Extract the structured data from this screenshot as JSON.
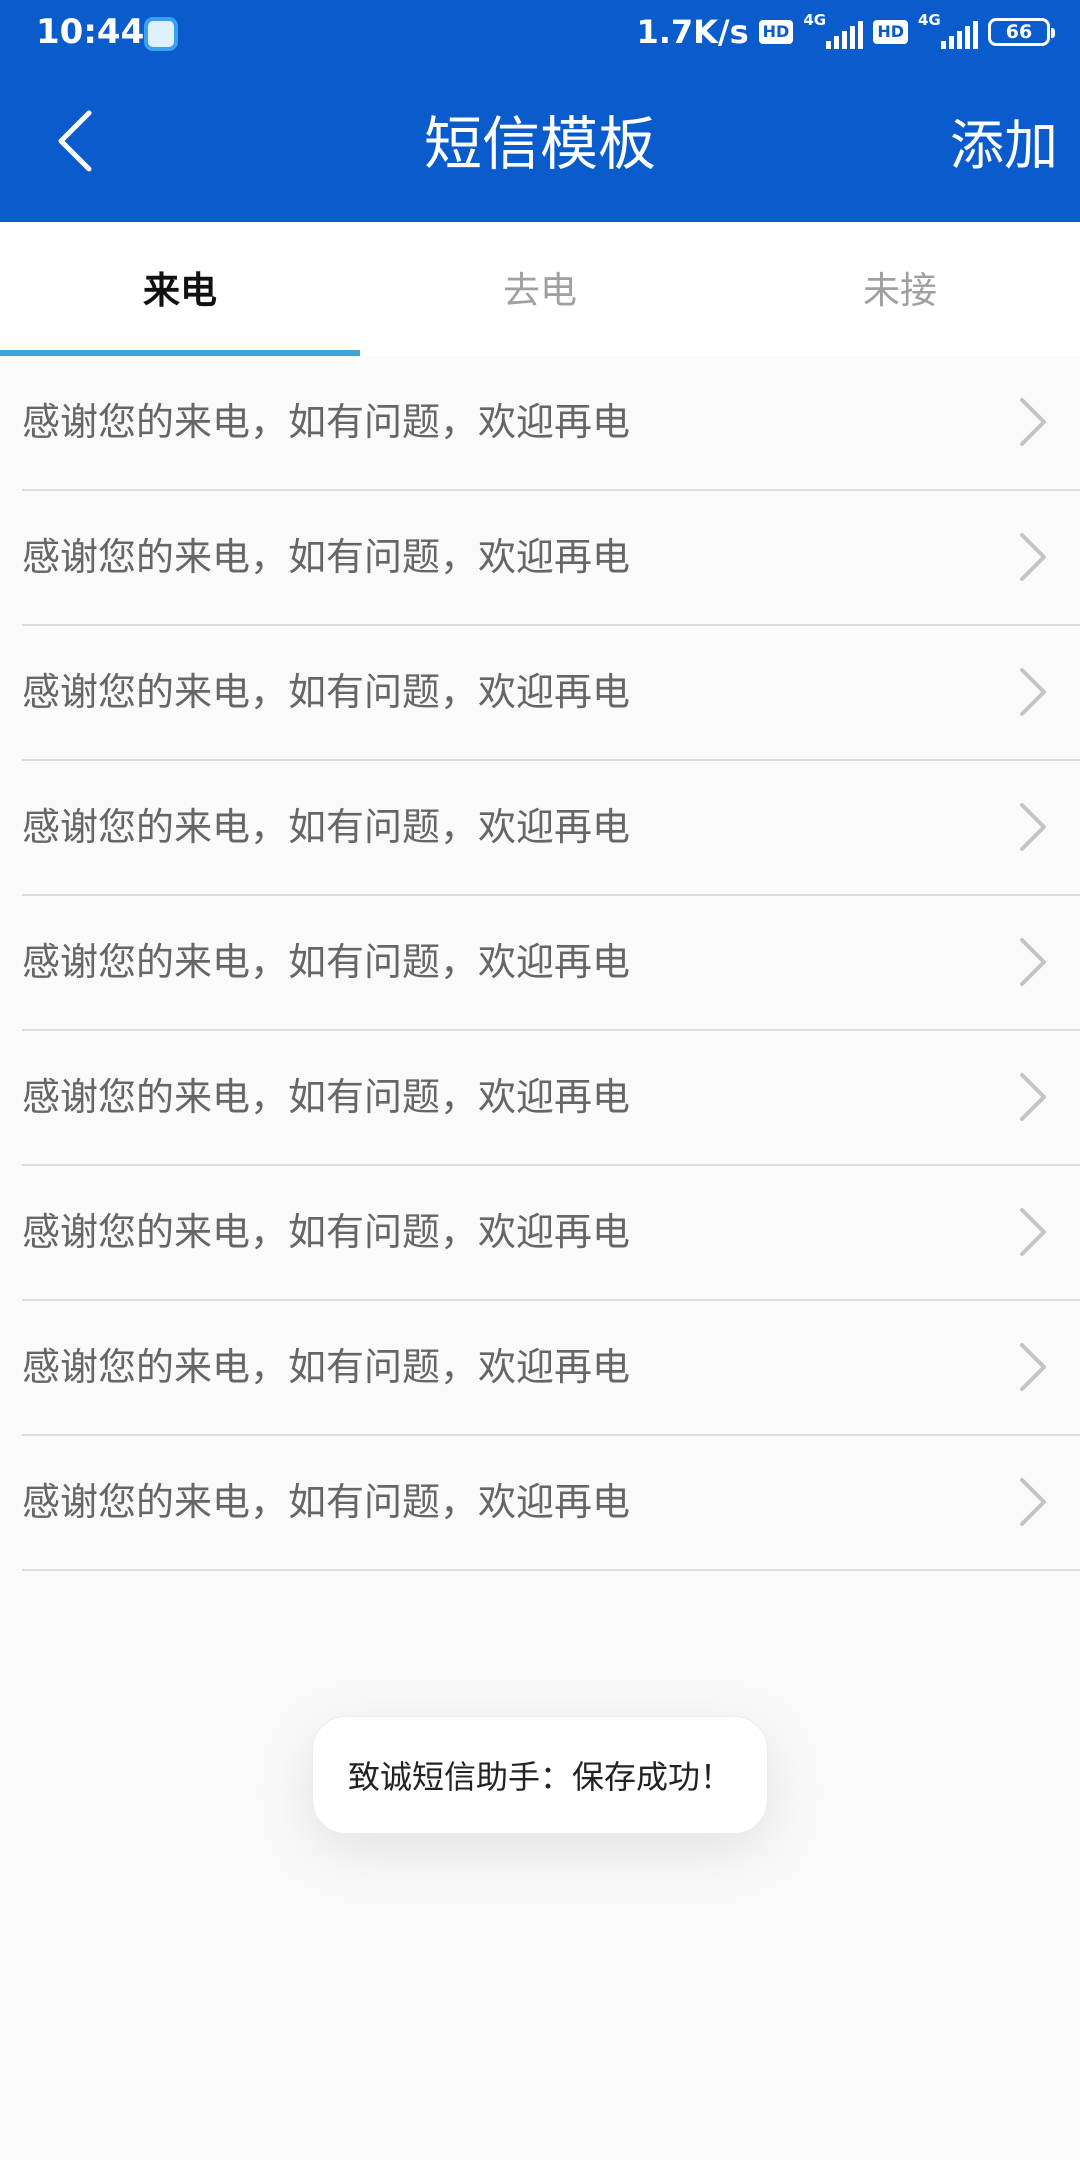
{
  "status_bar": {
    "time": "10:44",
    "net_speed": "1.7K/s",
    "hd_label": "HD",
    "network_label": "4G",
    "battery": "66"
  },
  "header": {
    "title": "短信模板",
    "add_label": "添加",
    "background_color": "#0a5bcb"
  },
  "tabs": [
    {
      "label": "来电",
      "active": true
    },
    {
      "label": "去电",
      "active": false
    },
    {
      "label": "未接",
      "active": false
    }
  ],
  "templates": [
    {
      "text": "感谢您的来电，如有问题，欢迎再电"
    },
    {
      "text": "感谢您的来电，如有问题，欢迎再电"
    },
    {
      "text": "感谢您的来电，如有问题，欢迎再电"
    },
    {
      "text": "感谢您的来电，如有问题，欢迎再电"
    },
    {
      "text": "感谢您的来电，如有问题，欢迎再电"
    },
    {
      "text": "感谢您的来电，如有问题，欢迎再电"
    },
    {
      "text": "感谢您的来电，如有问题，欢迎再电"
    },
    {
      "text": "感谢您的来电，如有问题，欢迎再电"
    },
    {
      "text": "感谢您的来电，如有问题，欢迎再电"
    }
  ],
  "toast": {
    "message": "致诚短信助手：保存成功！"
  },
  "icons": {
    "back": "chevron-left-icon",
    "row_arrow": "chevron-right-icon"
  },
  "colors": {
    "tab_indicator": "#3aa7dc",
    "divider": "#dcdcdc"
  }
}
